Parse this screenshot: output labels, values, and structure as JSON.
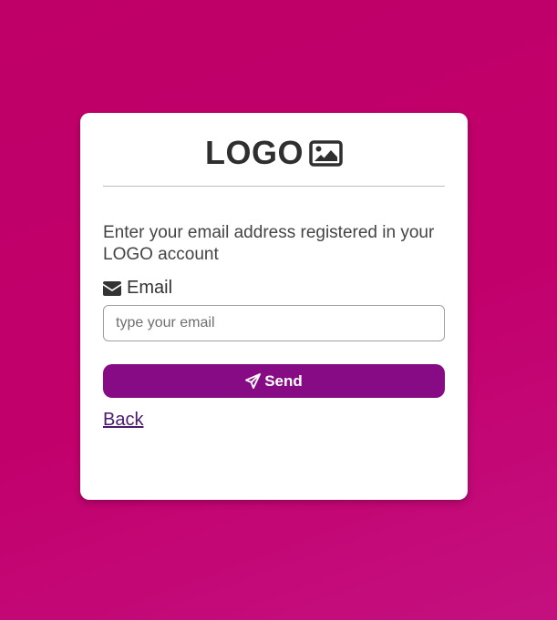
{
  "logo": {
    "text": "LOGO",
    "icon": "image-icon"
  },
  "form": {
    "description": "Enter your email address registered in your LOGO account",
    "email_label": "Email",
    "email_icon": "envelope-icon",
    "email_placeholder": "type your email",
    "email_value": "",
    "send_label": "Send",
    "send_icon": "paper-plane-icon",
    "back_label": "Back"
  },
  "colors": {
    "background": "#c2006c",
    "card": "#ffffff",
    "button": "#860b85",
    "link": "#4a1a6e"
  }
}
